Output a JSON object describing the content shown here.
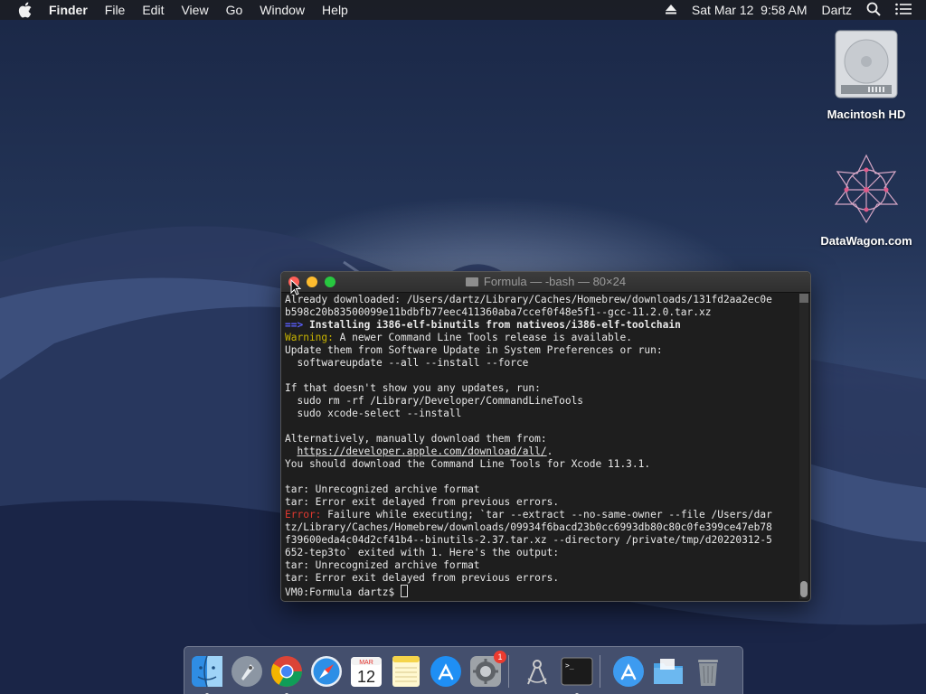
{
  "menubar": {
    "app": "Finder",
    "items": [
      "File",
      "Edit",
      "View",
      "Go",
      "Window",
      "Help"
    ],
    "datetime": "Sat Mar 12  9:58 AM",
    "user": "Dartz"
  },
  "desktop": {
    "icons": [
      {
        "label": "Macintosh HD",
        "icon": "hard-drive-icon"
      },
      {
        "label": "DataWagon.com",
        "icon": "network-logo-icon"
      }
    ]
  },
  "terminal": {
    "title": "Formula — -bash — 80×24",
    "lines": [
      {
        "parts": [
          {
            "t": "Already downloaded: /Users/dartz/Library/Caches/Homebrew/downloads/131fd2aa2ec0e",
            "c": ""
          }
        ]
      },
      {
        "parts": [
          {
            "t": "b598c20b83500099e11bdbfb77eec411360aba7ccef0f48e5f1--gcc-11.2.0.tar.xz",
            "c": ""
          }
        ]
      },
      {
        "parts": [
          {
            "t": "==>",
            "c": "c-blue"
          },
          {
            "t": " Installing i386-elf-binutils from nativeos/i386-elf-toolchain",
            "c": "c-bold"
          }
        ]
      },
      {
        "parts": [
          {
            "t": "Warning:",
            "c": "c-yellow"
          },
          {
            "t": " A newer Command Line Tools release is available.",
            "c": ""
          }
        ]
      },
      {
        "parts": [
          {
            "t": "Update them from Software Update in System Preferences or run:",
            "c": ""
          }
        ]
      },
      {
        "parts": [
          {
            "t": "  softwareupdate --all --install --force",
            "c": ""
          }
        ]
      },
      {
        "parts": [
          {
            "t": "",
            "c": ""
          }
        ]
      },
      {
        "parts": [
          {
            "t": "If that doesn't show you any updates, run:",
            "c": ""
          }
        ]
      },
      {
        "parts": [
          {
            "t": "  sudo rm -rf /Library/Developer/CommandLineTools",
            "c": ""
          }
        ]
      },
      {
        "parts": [
          {
            "t": "  sudo xcode-select --install",
            "c": ""
          }
        ]
      },
      {
        "parts": [
          {
            "t": "",
            "c": ""
          }
        ]
      },
      {
        "parts": [
          {
            "t": "Alternatively, manually download them from:",
            "c": ""
          }
        ]
      },
      {
        "parts": [
          {
            "t": "  ",
            "c": ""
          },
          {
            "t": "https://developer.apple.com/download/all/",
            "c": "c-ul"
          },
          {
            "t": ".",
            "c": ""
          }
        ]
      },
      {
        "parts": [
          {
            "t": "You should download the Command Line Tools for Xcode 11.3.1.",
            "c": ""
          }
        ]
      },
      {
        "parts": [
          {
            "t": "",
            "c": ""
          }
        ]
      },
      {
        "parts": [
          {
            "t": "tar: Unrecognized archive format",
            "c": ""
          }
        ]
      },
      {
        "parts": [
          {
            "t": "tar: Error exit delayed from previous errors.",
            "c": ""
          }
        ]
      },
      {
        "parts": [
          {
            "t": "Error:",
            "c": "c-red"
          },
          {
            "t": " Failure while executing; `tar --extract --no-same-owner --file /Users/dar",
            "c": ""
          }
        ]
      },
      {
        "parts": [
          {
            "t": "tz/Library/Caches/Homebrew/downloads/09934f6bacd23b0cc6993db80c80c0fe399ce47eb78",
            "c": ""
          }
        ]
      },
      {
        "parts": [
          {
            "t": "f39600eda4c04d2cf41b4--binutils-2.37.tar.xz --directory /private/tmp/d20220312-5",
            "c": ""
          }
        ]
      },
      {
        "parts": [
          {
            "t": "652-tep3to` exited with 1. Here's the output:",
            "c": ""
          }
        ]
      },
      {
        "parts": [
          {
            "t": "tar: Unrecognized archive format",
            "c": ""
          }
        ]
      },
      {
        "parts": [
          {
            "t": "tar: Error exit delayed from previous errors.",
            "c": ""
          }
        ]
      },
      {
        "parts": [
          {
            "t": "VM0:Formula dartz$ ",
            "c": ""
          }
        ]
      }
    ]
  },
  "dock": {
    "items": [
      {
        "name": "finder-icon",
        "running": true
      },
      {
        "name": "launchpad-icon",
        "running": false
      },
      {
        "name": "chrome-icon",
        "running": true
      },
      {
        "name": "safari-icon",
        "running": false
      },
      {
        "name": "calendar-icon",
        "running": false,
        "month": "MAR",
        "day": "12"
      },
      {
        "name": "notes-icon",
        "running": false
      },
      {
        "name": "app-store-icon",
        "running": false
      },
      {
        "name": "system-preferences-icon",
        "running": false,
        "badge": "1"
      },
      {
        "name": "sep"
      },
      {
        "name": "instruments-icon",
        "running": false
      },
      {
        "name": "terminal-icon",
        "running": true
      },
      {
        "name": "sep"
      },
      {
        "name": "app-store-downloads-icon",
        "running": false
      },
      {
        "name": "folder-icon",
        "running": false
      },
      {
        "name": "trash-icon",
        "running": false
      }
    ]
  }
}
